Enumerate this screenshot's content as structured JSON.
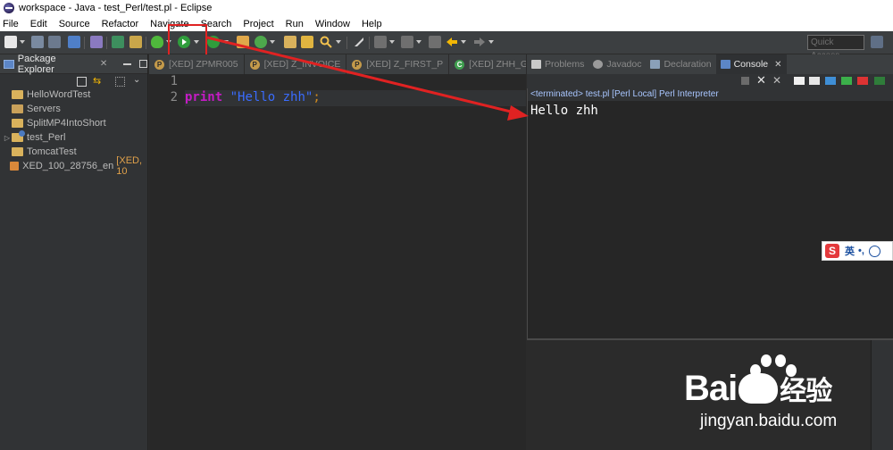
{
  "window": {
    "title": "workspace - Java - test_Perl/test.pl - Eclipse"
  },
  "menu": [
    "File",
    "Edit",
    "Source",
    "Refactor",
    "Navigate",
    "Search",
    "Project",
    "Run",
    "Window",
    "Help"
  ],
  "toolbar": {
    "quick_access_placeholder": "Quick Access"
  },
  "package_explorer": {
    "title": "Package Explorer",
    "items": [
      {
        "label": "HelloWordTest",
        "expandable": false,
        "extra": ""
      },
      {
        "label": "Servers",
        "expandable": false,
        "extra": ""
      },
      {
        "label": "SplitMP4IntoShort",
        "expandable": false,
        "extra": ""
      },
      {
        "label": "test_Perl",
        "expandable": true,
        "extra": ""
      },
      {
        "label": "TomcatTest",
        "expandable": false,
        "extra": ""
      },
      {
        "label": "XED_100_28756_en",
        "expandable": false,
        "extra": "[XED, 10"
      }
    ]
  },
  "editor": {
    "tabs": [
      {
        "badge": "P",
        "label": "[XED] ZPMR005"
      },
      {
        "badge": "P",
        "label": "[XED] Z_INVOICE"
      },
      {
        "badge": "P",
        "label": "[XED] Z_FIRST_P"
      },
      {
        "badge": "C",
        "label": "[XED] ZHH_G"
      }
    ],
    "line_numbers": [
      "1",
      "2"
    ],
    "code": {
      "keyword": "print",
      "string": "\"Hello zhh\"",
      "terminator": ";"
    }
  },
  "console": {
    "tabs": [
      "Problems",
      "Javadoc",
      "Declaration",
      "Console"
    ],
    "active_tab": "Console",
    "status": "<terminated> test.pl [Perl Local] Perl Interpreter",
    "output": "Hello zhh"
  },
  "ime": {
    "logo": "S",
    "mode": "英",
    "punct": "•,"
  },
  "watermark": {
    "brand": "Bai",
    "brand_cn": "经验",
    "url": "jingyan.baidu.com"
  },
  "colors": {
    "annotation": "#e02222",
    "keyword": "#c51bc5",
    "string": "#3a6cff"
  }
}
